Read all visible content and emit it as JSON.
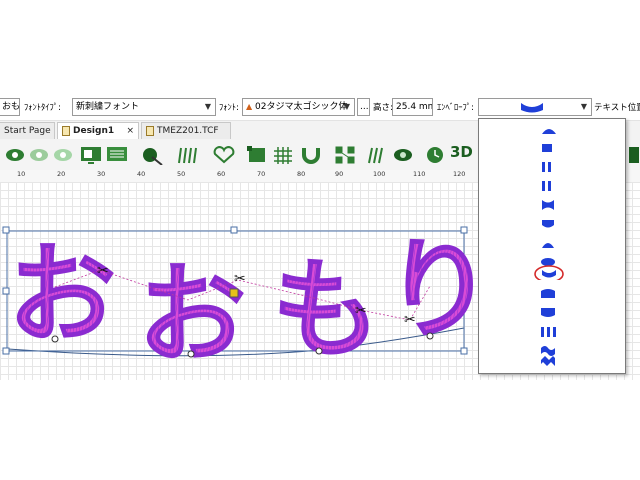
{
  "text_toolbar": {
    "text_value": "おもり",
    "font_type_label": "ﾌｫﾝﾄﾀｲﾌﾟ:",
    "font_type_value": "新刺繍フォント",
    "font_label": "ﾌｫﾝﾄ:",
    "font_value": "02タジマ太ゴシック体",
    "browse_label": "...",
    "height_label": "高さ:",
    "height_value": "25.4 mm",
    "envelope_label": "ｴﾝﾍﾞﾛｰﾌﾟ:",
    "text_position_label": "テキスト位置調"
  },
  "tabs": [
    {
      "label": "Start Page"
    },
    {
      "label": "Design1",
      "close": "×"
    },
    {
      "label": "TMEZ201.TCF"
    }
  ],
  "toolbar_icons": [
    "view-icon",
    "show-hide-icon",
    "preview-icon",
    "design-view-icon",
    "grid-view-icon",
    "stitch-tool-icon",
    "satin-icon",
    "heart-shape-icon",
    "select-area-icon",
    "grid-icon",
    "magnet-icon",
    "arrange-icon",
    "stitch-density-icon",
    "realistic-view-icon",
    "clock-icon",
    "3d-view-icon",
    "color-icon"
  ],
  "toolbar_text": {
    "three_d": "3D"
  },
  "ruler": {
    "ticks": [
      "10",
      "20",
      "30",
      "40",
      "50",
      "60",
      "70",
      "80",
      "90",
      "100",
      "110",
      "120"
    ]
  },
  "design": {
    "text": [
      "お",
      "お",
      "も",
      "り"
    ],
    "thread_color": "#d94bd6",
    "accent_color": "#7a2bd6"
  },
  "envelope": {
    "options": [
      "arc-top",
      "rectangle",
      "bars",
      "pinched",
      "bulge-down",
      "mound",
      "oval",
      "arc-bottom",
      "arch-down",
      "arch-up",
      "wave",
      "zigzag"
    ],
    "selected_index": 7,
    "highlight_color": "#d42a2a"
  }
}
